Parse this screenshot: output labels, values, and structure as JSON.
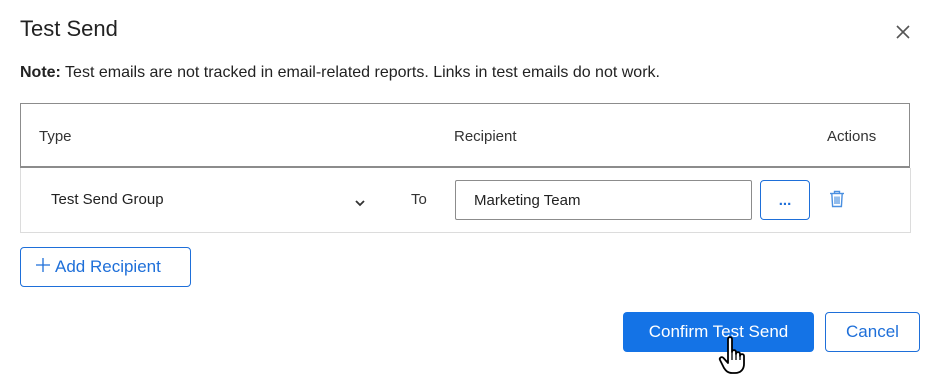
{
  "dialog": {
    "title": "Test Send",
    "close_icon": "close-icon"
  },
  "note": {
    "label": "Note:",
    "text": " Test emails are not tracked in email-related reports. Links in test emails do not work."
  },
  "table": {
    "headers": {
      "type": "Type",
      "recipient": "Recipient",
      "actions": "Actions"
    },
    "rows": [
      {
        "type": "Test Send Group",
        "connector": "To",
        "recipient": "Marketing Team",
        "more_label": "...",
        "delete_icon": "trash-icon"
      }
    ]
  },
  "buttons": {
    "add_recipient": "Add Recipient",
    "confirm": "Confirm Test Send",
    "cancel": "Cancel"
  },
  "colors": {
    "accent": "#1473e6",
    "border": "#8c8c8c"
  }
}
